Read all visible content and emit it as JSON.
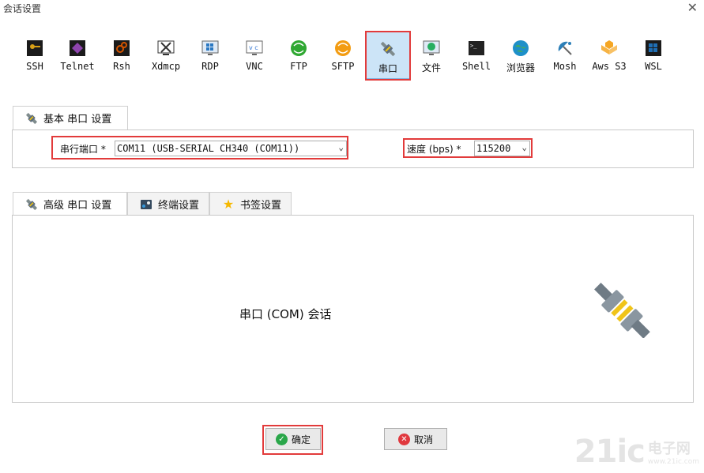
{
  "window": {
    "title": "会话设置",
    "close_glyph": "✕"
  },
  "protocols": [
    {
      "label": "SSH",
      "icon": "key-icon",
      "color": "#d8a017"
    },
    {
      "label": "Telnet",
      "icon": "telnet-icon",
      "color": "#8e44ad"
    },
    {
      "label": "Rsh",
      "icon": "rsh-icon",
      "color": "#d35400"
    },
    {
      "label": "Xdmcp",
      "icon": "xdmcp-icon",
      "color": "#333333"
    },
    {
      "label": "RDP",
      "icon": "rdp-icon",
      "color": "#2b78c2"
    },
    {
      "label": "VNC",
      "icon": "vnc-icon",
      "color": "#3a7bd5"
    },
    {
      "label": "FTP",
      "icon": "ftp-icon",
      "color": "#2fa832"
    },
    {
      "label": "SFTP",
      "icon": "sftp-icon",
      "color": "#f39c12"
    },
    {
      "label": "串口",
      "icon": "serial-plug-icon",
      "color": "#5d6d7e",
      "selected": true
    },
    {
      "label": "文件",
      "icon": "file-icon",
      "color": "#27ae60"
    },
    {
      "label": "Shell",
      "icon": "shell-icon",
      "color": "#222222"
    },
    {
      "label": "浏览器",
      "icon": "browser-globe-icon",
      "color": "#1e90c9"
    },
    {
      "label": "Mosh",
      "icon": "mosh-satellite-icon",
      "color": "#2c7fb8"
    },
    {
      "label": "Aws S3",
      "icon": "aws-s3-icon",
      "color": "#f5a623"
    },
    {
      "label": "WSL",
      "icon": "wsl-windows-icon",
      "color": "#1f6fb5"
    }
  ],
  "basic_tab": {
    "label": "基本 串口 设置"
  },
  "serial_port": {
    "label": "串行端口 *",
    "value": "COM11  (USB-SERIAL CH340 (COM11))"
  },
  "speed": {
    "label": "速度 (bps) *",
    "value": "115200"
  },
  "advanced_tabs": [
    {
      "label": "高级 串口 设置",
      "icon": "serial-plug-icon",
      "active": true
    },
    {
      "label": "终端设置",
      "icon": "terminal-settings-icon"
    },
    {
      "label": "书签设置",
      "icon": "star-icon"
    }
  ],
  "panel_text": "串口 (COM) 会话",
  "buttons": {
    "ok": "确定",
    "cancel": "取消"
  },
  "colors": {
    "highlight": "#e23b3b",
    "selected_bg": "#cce4f7",
    "ok_icon": "#2aa74a",
    "cancel_icon": "#e0383e"
  },
  "watermark": {
    "big": "21ic",
    "cn": "电子网",
    "url": "www.21ic.com"
  }
}
